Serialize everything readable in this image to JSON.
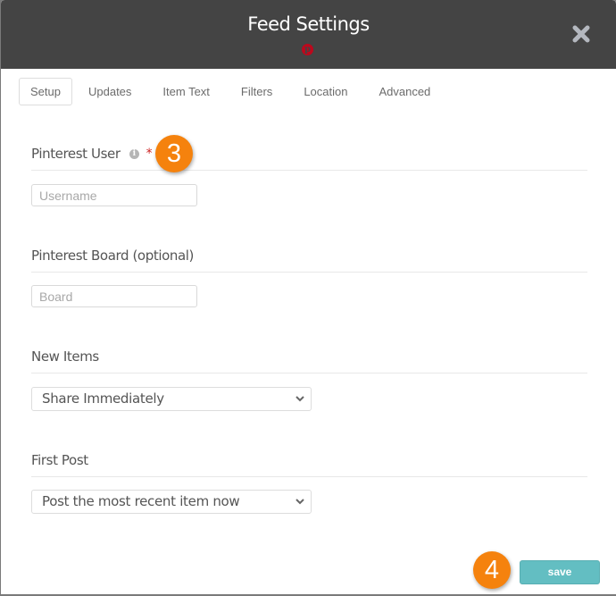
{
  "dialog": {
    "title": "Feed Settings",
    "network_icon": "pinterest-icon",
    "close_icon": "close-icon"
  },
  "tabs": [
    {
      "label": "Setup",
      "active": true
    },
    {
      "label": "Updates",
      "active": false
    },
    {
      "label": "Item Text",
      "active": false
    },
    {
      "label": "Filters",
      "active": false
    },
    {
      "label": "Location",
      "active": false
    },
    {
      "label": "Advanced",
      "active": false
    }
  ],
  "fields": {
    "pinterest_user": {
      "label": "Pinterest User",
      "required_marker": "*",
      "value": "",
      "placeholder": "Username"
    },
    "pinterest_board": {
      "label": "Pinterest Board (optional)",
      "value": "",
      "placeholder": "Board"
    },
    "new_items": {
      "label": "New Items",
      "selected": "Share Immediately"
    },
    "first_post": {
      "label": "First Post",
      "selected": "Post the most recent item now"
    }
  },
  "annotations": {
    "step_3": "3",
    "step_4": "4"
  },
  "actions": {
    "save_label": "save"
  },
  "colors": {
    "header_bg": "#444444",
    "pinterest_red": "#bd081c",
    "badge_orange": "#f5820d",
    "save_teal": "#63bec2",
    "required_red": "#cc2222"
  }
}
